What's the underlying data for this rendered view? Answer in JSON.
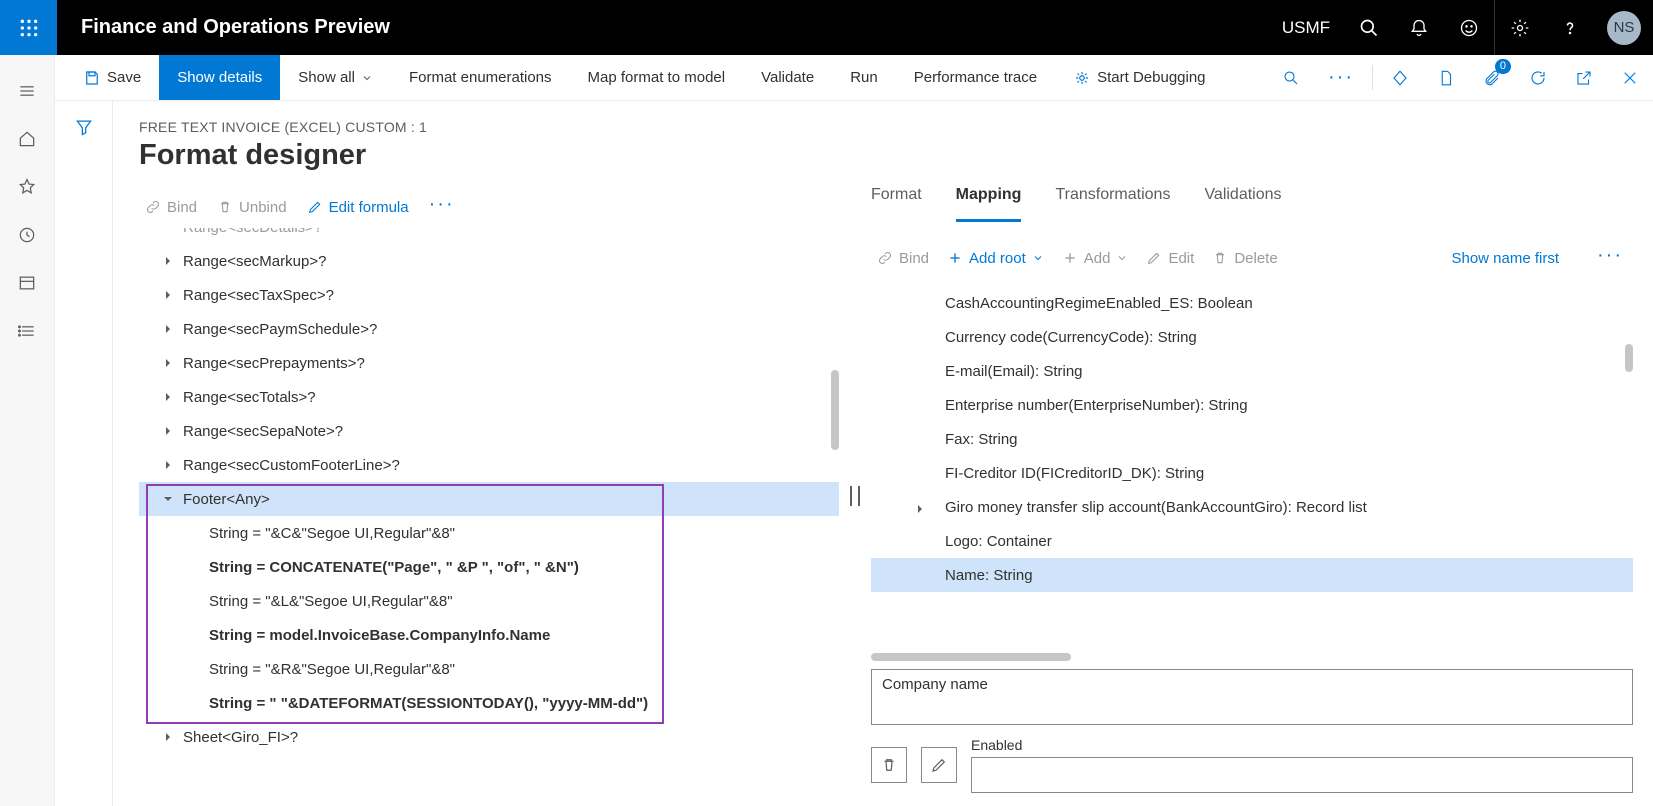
{
  "header": {
    "app_title": "Finance and Operations Preview",
    "company": "USMF",
    "avatar_initials": "NS"
  },
  "command_bar": {
    "save": "Save",
    "show_details": "Show details",
    "show_all": "Show all",
    "format_enumerations": "Format enumerations",
    "map_format": "Map format to model",
    "validate": "Validate",
    "run": "Run",
    "performance_trace": "Performance trace",
    "start_debugging": "Start Debugging",
    "attachment_badge": "0"
  },
  "page": {
    "breadcrumb": "FREE TEXT INVOICE (EXCEL) CUSTOM : 1",
    "title": "Format designer"
  },
  "left_toolbar": {
    "bind": "Bind",
    "unbind": "Unbind",
    "edit_formula": "Edit formula"
  },
  "tree": [
    {
      "indent": 1,
      "caret": "none",
      "text": "Range<secDetails>?"
    },
    {
      "indent": 1,
      "caret": "right",
      "text": "Range<secMarkup>?"
    },
    {
      "indent": 1,
      "caret": "right",
      "text": "Range<secTaxSpec>?"
    },
    {
      "indent": 1,
      "caret": "right",
      "text": "Range<secPaymSchedule>?"
    },
    {
      "indent": 1,
      "caret": "right",
      "text": "Range<secPrepayments>?"
    },
    {
      "indent": 1,
      "caret": "right",
      "text": "Range<secTotals>?"
    },
    {
      "indent": 1,
      "caret": "right",
      "text": "Range<secSepaNote>?"
    },
    {
      "indent": 1,
      "caret": "right",
      "text": "Range<secCustomFooterLine>?"
    },
    {
      "indent": 1,
      "caret": "down",
      "text": "Footer<Any>",
      "selected": true
    },
    {
      "indent": 2,
      "caret": "none",
      "text": "String = \"&C&\"Segoe UI,Regular\"&8\""
    },
    {
      "indent": 2,
      "caret": "none",
      "text": "String = CONCATENATE(\"Page\", \" &P \", \"of\", \" &N\")",
      "bold": true
    },
    {
      "indent": 2,
      "caret": "none",
      "text": "String = \"&L&\"Segoe UI,Regular\"&8\""
    },
    {
      "indent": 2,
      "caret": "none",
      "text": "String = model.InvoiceBase.CompanyInfo.Name",
      "bold": true
    },
    {
      "indent": 2,
      "caret": "none",
      "text": "String = \"&R&\"Segoe UI,Regular\"&8\""
    },
    {
      "indent": 2,
      "caret": "none",
      "text": "String = \" \"&DATEFORMAT(SESSIONTODAY(), \"yyyy-MM-dd\")",
      "bold": true
    },
    {
      "indent": 1,
      "caret": "right",
      "text": "Sheet<Giro_FI>?"
    }
  ],
  "tabs": {
    "format": "Format",
    "mapping": "Mapping",
    "transformations": "Transformations",
    "validations": "Validations"
  },
  "right_toolbar": {
    "bind": "Bind",
    "add_root": "Add root",
    "add": "Add",
    "edit": "Edit",
    "delete": "Delete",
    "show_name_first": "Show name first"
  },
  "mapping_items": [
    {
      "text": "CashAccountingRegimeEnabled_ES: Boolean"
    },
    {
      "text": "Currency code(CurrencyCode): String"
    },
    {
      "text": "E-mail(Email): String"
    },
    {
      "text": "Enterprise number(EnterpriseNumber): String"
    },
    {
      "text": "Fax: String"
    },
    {
      "text": "FI-Creditor ID(FICreditorID_DK): String"
    },
    {
      "text": "Giro money transfer slip account(BankAccountGiro): Record list",
      "caret": true
    },
    {
      "text": "Logo: Container"
    },
    {
      "text": "Name: String",
      "selected": true
    }
  ],
  "detail": {
    "company_name": "Company name",
    "enabled_label": "Enabled"
  }
}
